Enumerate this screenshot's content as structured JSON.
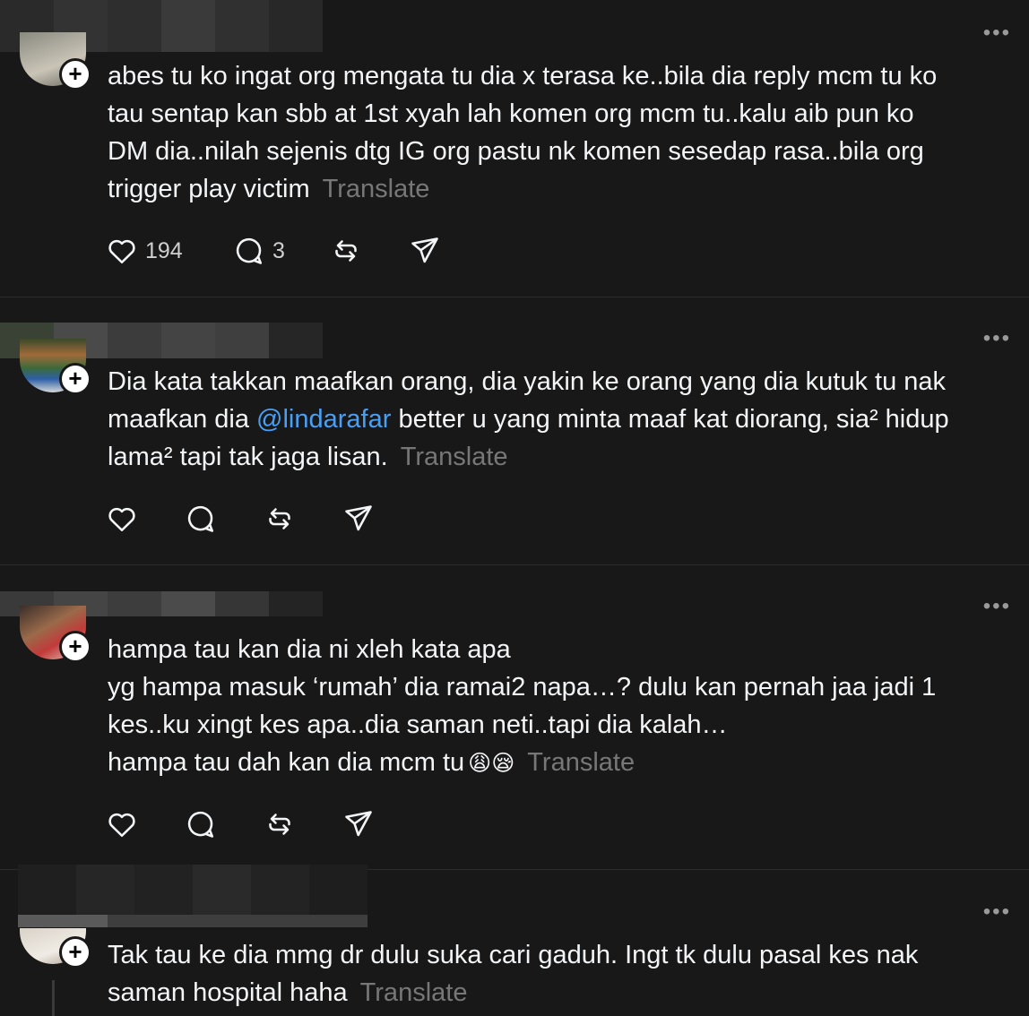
{
  "colors": {
    "background": "#181818",
    "text": "#f3f5f7",
    "muted": "#777777",
    "mention": "#4a9ff5"
  },
  "icons": {
    "like": "heart-icon",
    "reply": "comment-icon",
    "repost": "repost-icon",
    "share": "send-icon",
    "more": "more-icon",
    "follow": "plus-icon"
  },
  "posts": [
    {
      "lines": [
        "abes tu ko ingat org mengata tu dia x terasa ke..bila dia reply mcm tu ko",
        "tau sentap kan sbb at 1st xyah lah komen org mcm tu..kalu aib pun ko",
        "DM dia..nilah sejenis dtg IG org pastu nk komen sesedap rasa..bila org",
        "trigger play victim"
      ],
      "translate": "Translate",
      "likes": "194",
      "replies": "3"
    },
    {
      "line1": "Dia kata takkan maafkan orang, dia yakin ke orang yang dia kutuk tu nak",
      "line2_pre": "maafkan dia ",
      "mention": "@lindarafar",
      "line2_post": " better u yang minta maaf kat diorang, sia² hidup",
      "line3": "lama² tapi tak jaga lisan.",
      "translate": "Translate"
    },
    {
      "lines": [
        "hampa tau kan dia ni xleh kata apa",
        "yg hampa masuk ‘rumah’ dia ramai2 napa…? dulu kan pernah jaa jadi 1",
        "kes..ku xingt kes apa..dia saman neti..tapi dia kalah…",
        "hampa tau dah kan dia mcm tu"
      ],
      "emoji": "😩😪",
      "translate": "Translate"
    },
    {
      "lines": [
        "Tak tau ke dia mmg dr dulu suka cari gaduh. Ingt tk dulu pasal kes nak",
        "saman hospital haha"
      ],
      "translate": "Translate"
    }
  ],
  "more_label": "•••",
  "plus_label": "+"
}
